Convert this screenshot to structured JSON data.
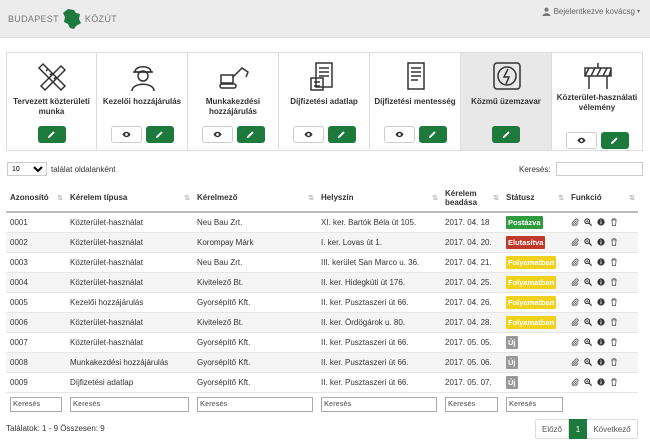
{
  "header": {
    "logo_left": "BUDAPEST",
    "logo_right": "KÖZÚT",
    "user_text": "Bejelentkezve kovácsg"
  },
  "cards": [
    {
      "title": "Tervezett közterületi munka",
      "icon": "pencil-ruler-icon",
      "view": false
    },
    {
      "title": "Kezelői hozzájárulás",
      "icon": "worker-icon",
      "view": true
    },
    {
      "title": "Munkakezdési hozzájárulás",
      "icon": "excavator-icon",
      "view": true
    },
    {
      "title": "Díjfizetési adatlap",
      "icon": "payment-form-icon",
      "view": true
    },
    {
      "title": "Díjfizetési mentesség",
      "icon": "document-icon",
      "view": true
    },
    {
      "title": "Közmű üzemzavar",
      "icon": "electric-fault-icon",
      "view": false
    },
    {
      "title": "Közterület-használati vélemény",
      "icon": "road-barrier-icon",
      "view": true
    }
  ],
  "controls": {
    "page_length": "10",
    "page_length_label": "találat oldalanként",
    "search_label": "Keresés:"
  },
  "table": {
    "headers": [
      "Azonosító",
      "Kérelem típusa",
      "Kérelmező",
      "Helyszín",
      "Kérelem beadása",
      "Státusz",
      "Funkció"
    ],
    "rows": [
      {
        "id": "0001",
        "type": "Közterület-használat",
        "applicant": "Neu Bau Zrt.",
        "location": "XI. ker. Bartók Béla út 105.",
        "date": "2017. 04. 18",
        "status": "Postázva",
        "status_color": "#2e9c3f"
      },
      {
        "id": "0002",
        "type": "Közterület-használat",
        "applicant": "Korompay Márk",
        "location": "I. ker. Lovas út 1.",
        "date": "2017. 04. 20.",
        "status": "Elutasítva",
        "status_color": "#c0392b"
      },
      {
        "id": "0003",
        "type": "Közterület-használat",
        "applicant": "Neu Bau Zrt.",
        "location": "III. kerület San Marco u. 36.",
        "date": "2017. 04. 21.",
        "status": "Folyamatban",
        "status_color": "#f0d11c"
      },
      {
        "id": "0004",
        "type": "Közterület-használat",
        "applicant": "Kivitelező Bt.",
        "location": "II. ker. Hidegkúti út 176.",
        "date": "2017. 04. 25.",
        "status": "Folyamatban",
        "status_color": "#f0d11c"
      },
      {
        "id": "0005",
        "type": "Kezelői hozzájárulás",
        "applicant": "Gyorsépítő Kft.",
        "location": "II. ker. Pusztaszeri út 66.",
        "date": "2017. 04. 26.",
        "status": "Folyamatban",
        "status_color": "#f0d11c"
      },
      {
        "id": "0006",
        "type": "Közterület-használat",
        "applicant": "Kivitelező Bt.",
        "location": "II. ker. Ördögárok u. 80.",
        "date": "2017. 04. 28.",
        "status": "Folyamatban",
        "status_color": "#f0d11c"
      },
      {
        "id": "0007",
        "type": "Közterület-használat",
        "applicant": "Gyorsépítő Kft.",
        "location": "II. ker. Pusztaszeri út 66.",
        "date": "2017. 05. 05.",
        "status": "Új",
        "status_color": "#999999"
      },
      {
        "id": "0008",
        "type": "Munkakezdési hozzájárulás",
        "applicant": "Gyorsépítő Kft.",
        "location": "II. ker. Pusztaszeri út 66.",
        "date": "2017. 05. 06.",
        "status": "Új",
        "status_color": "#999999"
      },
      {
        "id": "0009",
        "type": "Díjfizetési adatlap",
        "applicant": "Gyorsépítő Kft.",
        "location": "II. ker. Pusztaszeri út 66.",
        "date": "2017. 05. 07.",
        "status": "Új",
        "status_color": "#999999"
      }
    ],
    "filter_placeholder": "Keresés",
    "function_icons": [
      "attach-icon",
      "zoom-icon",
      "info-icon",
      "trash-icon"
    ]
  },
  "footer": {
    "info": "Találatok: 1 - 9 Összesen: 9",
    "prev": "Előző",
    "page": "1",
    "next": "Következő"
  },
  "colors": {
    "accent": "#1e7a3c"
  }
}
